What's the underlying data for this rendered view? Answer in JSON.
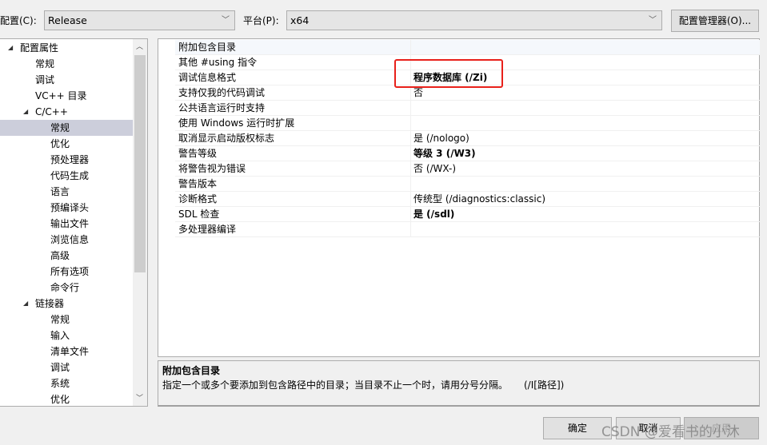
{
  "top": {
    "config_label": "配置(C):",
    "config_value": "Release",
    "platform_label": "平台(P):",
    "platform_value": "x64",
    "config_manager": "配置管理器(O)..."
  },
  "tree": [
    {
      "label": "配置属性",
      "level": 0,
      "expanded": true
    },
    {
      "label": "常规",
      "level": 1
    },
    {
      "label": "调试",
      "level": 1
    },
    {
      "label": "VC++ 目录",
      "level": 1
    },
    {
      "label": "C/C++",
      "level": 1,
      "expanded": true
    },
    {
      "label": "常规",
      "level": 2,
      "selected": true
    },
    {
      "label": "优化",
      "level": 2
    },
    {
      "label": "预处理器",
      "level": 2
    },
    {
      "label": "代码生成",
      "level": 2
    },
    {
      "label": "语言",
      "level": 2
    },
    {
      "label": "预编译头",
      "level": 2
    },
    {
      "label": "输出文件",
      "level": 2
    },
    {
      "label": "浏览信息",
      "level": 2
    },
    {
      "label": "高级",
      "level": 2
    },
    {
      "label": "所有选项",
      "level": 2
    },
    {
      "label": "命令行",
      "level": 2
    },
    {
      "label": "链接器",
      "level": 1,
      "expanded": true
    },
    {
      "label": "常规",
      "level": 2
    },
    {
      "label": "输入",
      "level": 2
    },
    {
      "label": "清单文件",
      "level": 2
    },
    {
      "label": "调试",
      "level": 2
    },
    {
      "label": "系统",
      "level": 2
    },
    {
      "label": "优化",
      "level": 2
    }
  ],
  "properties": [
    {
      "name": "附加包含目录",
      "value": ""
    },
    {
      "name": "其他 #using 指令",
      "value": ""
    },
    {
      "name": "调试信息格式",
      "value": "程序数据库 (/Zi)",
      "bold": true,
      "highlighted": true
    },
    {
      "name": "支持仅我的代码调试",
      "value": "否"
    },
    {
      "name": "公共语言运行时支持",
      "value": ""
    },
    {
      "name": "使用 Windows 运行时扩展",
      "value": ""
    },
    {
      "name": "取消显示启动版权标志",
      "value": "是 (/nologo)"
    },
    {
      "name": "警告等级",
      "value": "等级 3 (/W3)",
      "bold": true
    },
    {
      "name": "将警告视为错误",
      "value": "否 (/WX-)"
    },
    {
      "name": "警告版本",
      "value": ""
    },
    {
      "name": "诊断格式",
      "value": "传统型 (/diagnostics:classic)"
    },
    {
      "name": "SDL 检查",
      "value": "是 (/sdl)",
      "bold": true
    },
    {
      "name": "多处理器编译",
      "value": ""
    }
  ],
  "description": {
    "title": "附加包含目录",
    "text": "指定一个或多个要添加到包含路径中的目录；当目录不止一个时，请用分号分隔。",
    "switch": "(/I[路径])"
  },
  "buttons": {
    "ok": "确定",
    "cancel": "取消",
    "apply": "应用"
  },
  "watermark": "CSDN @爱看书的小沐",
  "colors": {
    "highlight_box": "#e8201a",
    "selected_row": "#cccedb"
  }
}
